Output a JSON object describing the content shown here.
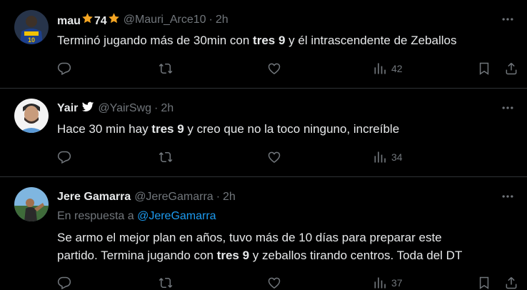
{
  "colors": {
    "background": "#000000",
    "text_primary": "#e7e9ea",
    "text_secondary": "#71767b",
    "link": "#1d9bf0",
    "divider": "#2f3336",
    "star": "#f5a623",
    "verified_badge": "#ffffff"
  },
  "tweets": [
    {
      "display_name_prefix": "mau",
      "display_name_number": "74",
      "handle": "@Mauri_Arce10",
      "separator": "·",
      "time": "2h",
      "text_before": "Terminó jugando más de 30min con ",
      "text_bold": "tres 9",
      "text_after": " y él intrascendente de Zeballos",
      "views": "42",
      "icons": [
        "more-icon",
        "reply-icon",
        "retweet-icon",
        "like-icon",
        "views-icon",
        "bookmark-icon",
        "share-icon"
      ]
    },
    {
      "display_name": "Yair",
      "handle": "@YairSwg",
      "separator": "·",
      "time": "2h",
      "text_before": "Hace 30 min hay ",
      "text_bold": "tres 9",
      "text_after": " y creo que no la toco ninguno, increíble",
      "views": "34",
      "icons": [
        "more-icon",
        "reply-icon",
        "retweet-icon",
        "like-icon",
        "views-icon"
      ]
    },
    {
      "display_name": "Jere Gamarra",
      "handle": "@JereGamarra",
      "separator": "·",
      "time": "2h",
      "reply_prefix": "En respuesta a ",
      "reply_mention": "@JereGamarra",
      "text_line1": "Se armo el mejor plan en años, tuvo más de 10 días para preparar este",
      "text_line2_before": "partido. Termina jugando con ",
      "text_bold": "tres 9",
      "text_line2_after": " y zeballos tirando centros. Toda del DT",
      "views": "37",
      "icons": [
        "more-icon",
        "reply-icon",
        "retweet-icon",
        "like-icon",
        "views-icon",
        "bookmark-icon",
        "share-icon"
      ]
    }
  ]
}
